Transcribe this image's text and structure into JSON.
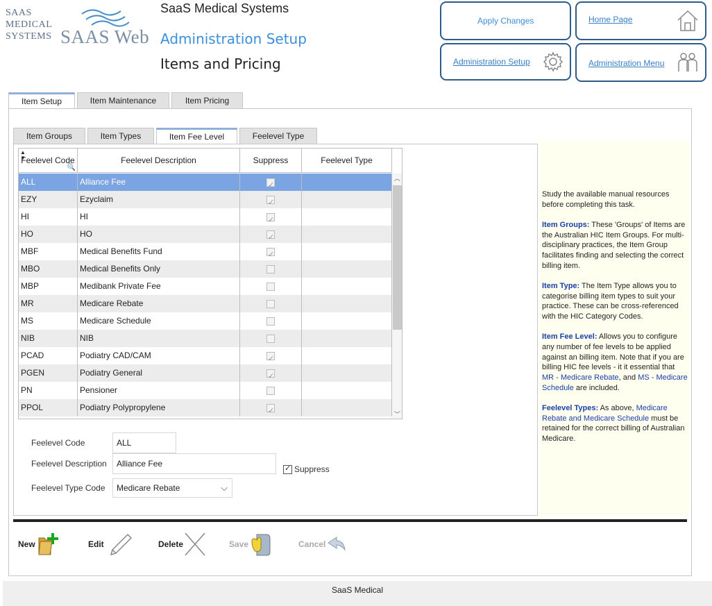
{
  "logo": {
    "line1": "SAAS",
    "line2": "MEDICAL",
    "line3": "SYSTEMS",
    "web": "SAAS Web"
  },
  "header": {
    "org_name": "SaaS Medical Systems",
    "section_title": "Administration Setup",
    "page_title": "Items and Pricing"
  },
  "header_buttons": {
    "apply": "Apply Changes",
    "home": "Home Page",
    "admin_setup": "Administration Setup",
    "admin_menu": "Administration Menu"
  },
  "outer_tabs": [
    "Item Setup",
    "Item Maintenance",
    "Item Pricing"
  ],
  "inner_tabs": [
    "Item Groups",
    "Item Types",
    "Item Fee Level",
    "Feelevel Type"
  ],
  "grid": {
    "columns": [
      "Feelevel Code",
      "Feelevel Description",
      "Suppress",
      "Feelevel Type"
    ],
    "rows": [
      {
        "code": "ALL",
        "description": "Alliance Fee",
        "suppress": true,
        "type": "",
        "selected": true
      },
      {
        "code": "EZY",
        "description": "Ezyclaim",
        "suppress": true,
        "type": ""
      },
      {
        "code": "HI",
        "description": "HI",
        "suppress": true,
        "type": ""
      },
      {
        "code": "HO",
        "description": "HO",
        "suppress": true,
        "type": ""
      },
      {
        "code": "MBF",
        "description": "Medical Benefits Fund",
        "suppress": true,
        "type": ""
      },
      {
        "code": "MBO",
        "description": "Medical Benefits Only",
        "suppress": false,
        "type": ""
      },
      {
        "code": "MBP",
        "description": "Medibank Private Fee",
        "suppress": false,
        "type": ""
      },
      {
        "code": "MR",
        "description": "Medicare Rebate",
        "suppress": false,
        "type": ""
      },
      {
        "code": "MS",
        "description": "Medicare Schedule",
        "suppress": false,
        "type": ""
      },
      {
        "code": "NIB",
        "description": "NIB",
        "suppress": false,
        "type": ""
      },
      {
        "code": "PCAD",
        "description": "Podiatry CAD/CAM",
        "suppress": true,
        "type": ""
      },
      {
        "code": "PGEN",
        "description": "Podiatry General",
        "suppress": true,
        "type": ""
      },
      {
        "code": "PN",
        "description": "Pensioner",
        "suppress": false,
        "type": ""
      },
      {
        "code": "PPOL",
        "description": "Podiatry Polypropylene",
        "suppress": true,
        "type": ""
      }
    ]
  },
  "form": {
    "code_label": "Feelevel Code",
    "code_value": "ALL",
    "description_label": "Feelevel Description",
    "description_value": "Alliance Fee",
    "suppress_label": "Suppress",
    "type_label": "Feelevel Type Code",
    "type_value": "Medicare Rebate"
  },
  "toolbar": {
    "new": "New",
    "edit": "Edit",
    "delete": "Delete",
    "save": "Save",
    "cancel": "Cancel"
  },
  "help": {
    "intro": "Study the available manual resources before completing this task.",
    "groups_title": "Item Groups:",
    "groups_text": " These 'Groups' of Items are the Australian HIC Item Groups. For multi-disciplinary practices, the Item Group facilitates finding and selecting the correct billing item.",
    "types_title": "Item Type:",
    "types_text": " The Item Type allows you to categorise billing item types to suit your practice. These can be cross-referenced with the HIC Category Codes.",
    "fee_title": "Item Fee Level:",
    "fee_text_1": " Allows you to configure any number of fee levels to be applied against an billing item. Note that if you are billing HIC fee levels - it it essential that ",
    "fee_mr": "MR - Medicare Rebate",
    "fee_and": ", and ",
    "fee_ms": "MS - Medicare Schedule",
    "fee_text_2": " are included.",
    "feetypes_title": "Feelevel Types:",
    "feetypes_text_1": " As above, ",
    "feetypes_blue": "Medicare Rebate and Medicare Schedule",
    "feetypes_text_2": " must be retained for the correct billing of Australian Medicare."
  },
  "footer": "SaaS Medical",
  "colors": {
    "accent": "#3c8fdd",
    "selected_row": "#7ba4e2",
    "button_border": "#2e5c8a",
    "help_bg": "#fffff0"
  }
}
